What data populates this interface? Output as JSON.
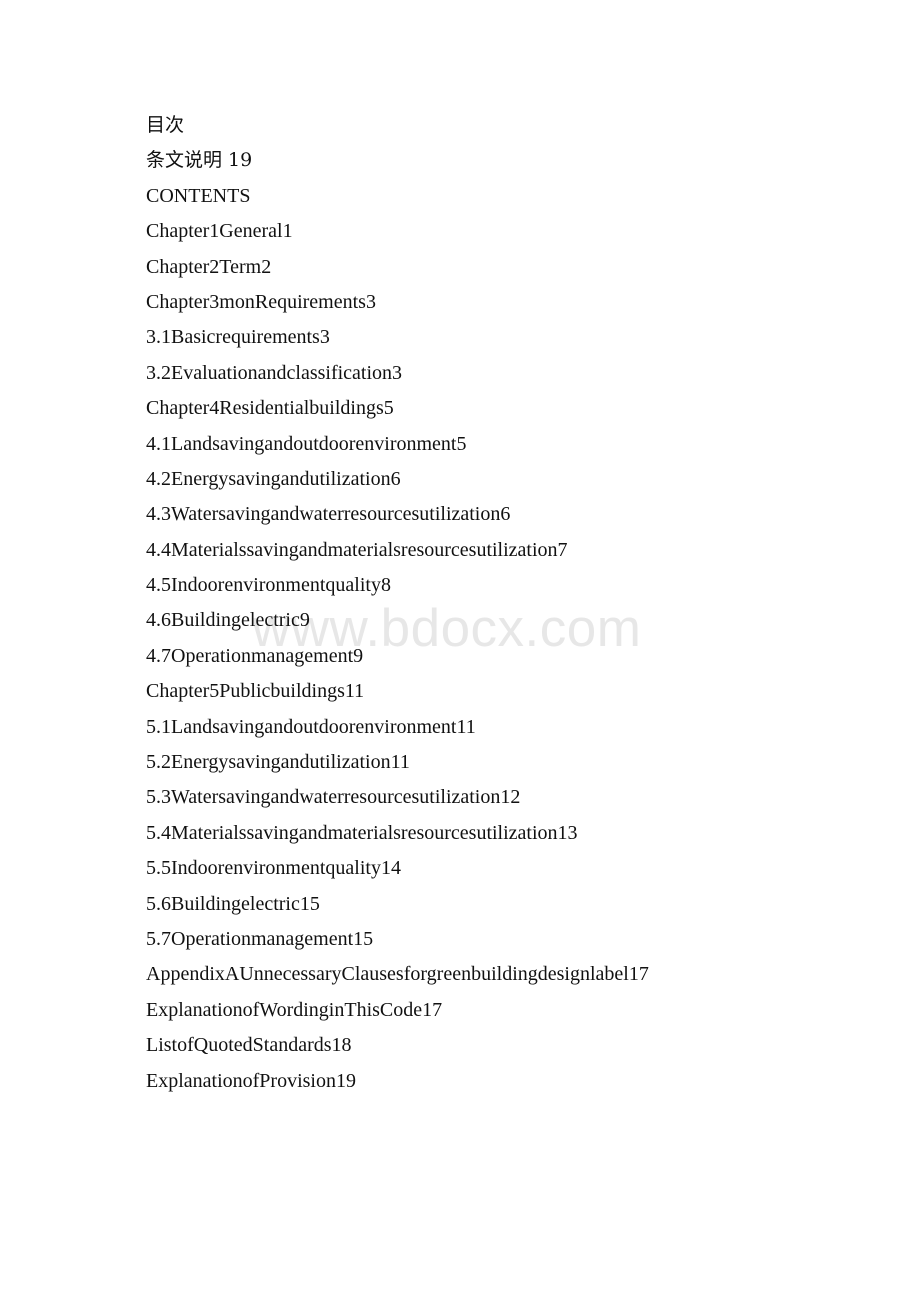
{
  "document": {
    "type": "table-of-contents",
    "background_color": "#ffffff",
    "text_color": "#111111"
  },
  "watermark": {
    "text": "www.bdocx.com",
    "color": "#e7e7e7"
  },
  "toc": {
    "lines": [
      {
        "text": "目次",
        "cjk": true
      },
      {
        "text": "条文说明 19",
        "cjk": true
      },
      {
        "text": "CONTENTS",
        "cjk": false
      },
      {
        "text": "Chapter1General1",
        "cjk": false
      },
      {
        "text": "Chapter2Term2",
        "cjk": false
      },
      {
        "text": "Chapter3monRequirements3",
        "cjk": false
      },
      {
        "text": "3.1Basicrequirements3",
        "cjk": false
      },
      {
        "text": "3.2Evaluationandclassification3",
        "cjk": false
      },
      {
        "text": "Chapter4Residentialbuildings5",
        "cjk": false
      },
      {
        "text": "4.1Landsavingandoutdoorenvironment5",
        "cjk": false
      },
      {
        "text": "4.2Energysavingandutilization6",
        "cjk": false
      },
      {
        "text": "4.3Watersavingandwaterresourcesutilization6",
        "cjk": false
      },
      {
        "text": "4.4Materialssavingandmaterialsresourcesutilization7",
        "cjk": false
      },
      {
        "text": "4.5Indoorenvironmentquality8",
        "cjk": false
      },
      {
        "text": "4.6Buildingelectric9",
        "cjk": false
      },
      {
        "text": "4.7Operationmanagement9",
        "cjk": false
      },
      {
        "text": "Chapter5Publicbuildings11",
        "cjk": false
      },
      {
        "text": "5.1Landsavingandoutdoorenvironment11",
        "cjk": false
      },
      {
        "text": "5.2Energysavingandutilization11",
        "cjk": false
      },
      {
        "text": "5.3Watersavingandwaterresourcesutilization12",
        "cjk": false
      },
      {
        "text": "5.4Materialssavingandmaterialsresourcesutilization13",
        "cjk": false
      },
      {
        "text": "5.5Indoorenvironmentquality14",
        "cjk": false
      },
      {
        "text": "5.6Buildingelectric15",
        "cjk": false
      },
      {
        "text": "5.7Operationmanagement15",
        "cjk": false
      },
      {
        "text": "AppendixAUnnecessaryClausesforgreenbuildingdesignlabel17",
        "cjk": false
      },
      {
        "text": "ExplanationofWordinginThisCode17",
        "cjk": false
      },
      {
        "text": "ListofQuotedStandards18",
        "cjk": false
      },
      {
        "text": "ExplanationofProvision19",
        "cjk": false
      }
    ]
  }
}
